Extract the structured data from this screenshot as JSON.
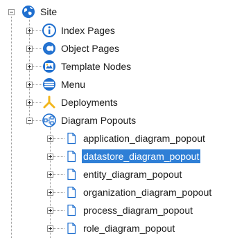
{
  "tree": {
    "root": {
      "label": "Site",
      "icon": "globe-icon",
      "expanded": true
    },
    "children": [
      {
        "label": "Index Pages",
        "icon": "info-icon",
        "expanded": false
      },
      {
        "label": "Object Pages",
        "icon": "object-pages-icon",
        "expanded": false
      },
      {
        "label": "Template Nodes",
        "icon": "template-icon",
        "expanded": false
      },
      {
        "label": "Menu",
        "icon": "menu-icon",
        "expanded": false
      },
      {
        "label": "Deployments",
        "icon": "deployments-icon",
        "expanded": false
      },
      {
        "label": "Diagram Popouts",
        "icon": "diagram-popouts-icon",
        "expanded": true,
        "children": [
          {
            "label": "application_diagram_popout",
            "icon": "page-icon"
          },
          {
            "label": "datastore_diagram_popout",
            "icon": "page-icon",
            "selected": true
          },
          {
            "label": "entity_diagram_popout",
            "icon": "page-icon"
          },
          {
            "label": "organization_diagram_popout",
            "icon": "page-icon"
          },
          {
            "label": "process_diagram_popout",
            "icon": "page-icon"
          },
          {
            "label": "role_diagram_popout",
            "icon": "page-icon"
          }
        ]
      }
    ]
  },
  "colors": {
    "selection": "#2f7fd6",
    "icon_blue": "#1f6fcf",
    "icon_yellow": "#f2b61c",
    "connector": "#9a9a9a"
  }
}
